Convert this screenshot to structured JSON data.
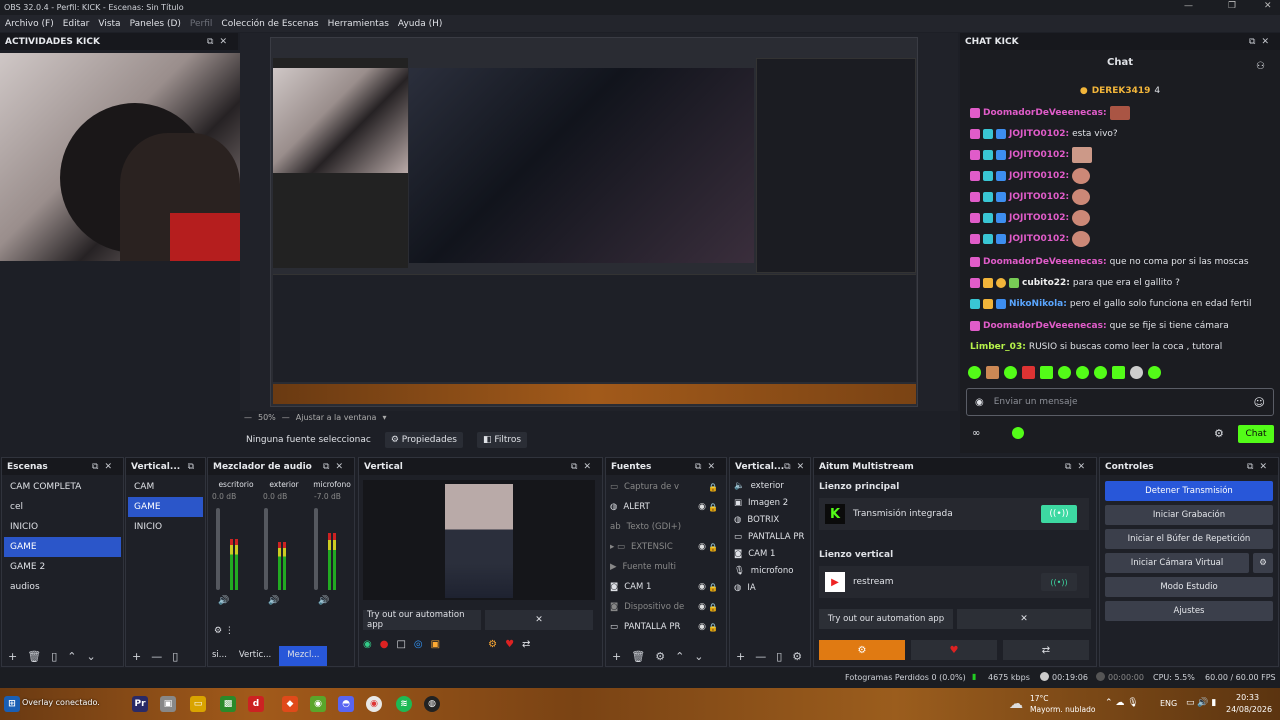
{
  "window": {
    "title": "OBS 32.0.4 - Perfil: KICK - Escenas: Sin Título"
  },
  "menu": [
    "Archivo (F)",
    "Editar",
    "Vista",
    "Paneles (D)",
    "Perfil",
    "Colección de Escenas",
    "Herramientas",
    "Ayuda (H)"
  ],
  "docks": {
    "actividades": "ACTIVIDADES KICK",
    "chat_kick": "CHAT KICK",
    "escenas": "Escenas",
    "vertical_scenes": "Vertical...",
    "mezclador": "Mezclador de audio",
    "vertical": "Vertical",
    "fuentes": "Fuentes",
    "vertical_sources": "Vertical...",
    "aitum": "Aitum Multistream",
    "controles": "Controles"
  },
  "preview": {
    "zoom": "50%",
    "fit": "Ajustar a la ventana",
    "no_source": "Ninguna fuente seleccionac",
    "props": "Propiedades",
    "filters": "Filtros"
  },
  "chat": {
    "title": "Chat",
    "pinned_user": "DEREK3419",
    "pinned_count": "4",
    "messages": [
      {
        "user": "DoomadorDeVeeenecas:",
        "text": "",
        "color": "#e05cc9"
      },
      {
        "user": "JOJITO0102:",
        "text": "esta vivo?",
        "color": "#e05cc9"
      },
      {
        "user": "JOJITO0102:",
        "text": "",
        "color": "#e05cc9"
      },
      {
        "user": "JOJITO0102:",
        "text": "",
        "color": "#e05cc9"
      },
      {
        "user": "JOJITO0102:",
        "text": "",
        "color": "#e05cc9"
      },
      {
        "user": "JOJITO0102:",
        "text": "",
        "color": "#e05cc9"
      },
      {
        "user": "JOJITO0102:",
        "text": "",
        "color": "#e05cc9"
      },
      {
        "user": "DoomadorDeVeeenecas:",
        "text": "que no coma por si las moscas",
        "color": "#e05cc9"
      },
      {
        "user": "cubito22:",
        "text": "para que era el gallito ?",
        "color": "#f0f0f0"
      },
      {
        "user": "NikoNikola:",
        "text": "pero el gallo solo funciona en edad fertil",
        "color": "#5aa6ff"
      },
      {
        "user": "DoomadorDeVeeenecas:",
        "text": "que se fije si tiene cámara",
        "color": "#e05cc9"
      },
      {
        "user": "Limber_03:",
        "text": "RUSIO si buscas como leer la coca , tutoral",
        "color": "#b7f34a"
      }
    ],
    "input_placeholder": "Enviar un mensaje",
    "send": "Chat"
  },
  "scenes": [
    "CAM COMPLETA",
    "cel",
    "INICIO",
    "GAME",
    "GAME 2",
    "audios"
  ],
  "scenes_selected": 3,
  "vertical_scenes": [
    "CAM",
    "GAME",
    "INICIO"
  ],
  "vertical_selected": 1,
  "mixer": [
    {
      "name": "escritorio",
      "db": "0.0 dB",
      "level": 0.62
    },
    {
      "name": "exterior",
      "db": "0.0 dB",
      "level": 0.58
    },
    {
      "name": "microfono",
      "db": "-7.0 dB",
      "level": 0.7
    }
  ],
  "mixer_tabs": [
    "si...",
    "Vertic...",
    "Mezcl..."
  ],
  "vertical_dock": {
    "automation": "Try out our automation app"
  },
  "sources": [
    "Captura de v",
    "ALERT",
    "Texto (GDI+)",
    "EXTENSIC",
    "Fuente multi",
    "CAM 1",
    "Dispositivo de",
    "PANTALLA PR"
  ],
  "vertical_sources": [
    "exterior",
    "Imagen 2",
    "BOTRIX",
    "PANTALLA PR",
    "CAM 1",
    "microfono",
    "IA"
  ],
  "aitum": {
    "main_canvas": "Lienzo principal",
    "integrated": "Transmisión integrada",
    "vertical_canvas": "Lienzo vertical",
    "restream": "restream",
    "automation": "Try out our automation app"
  },
  "controls": [
    "Detener Transmisión",
    "Iniciar Grabación",
    "Iniciar el Búfer de Repetición",
    "Iniciar Cámara Virtual",
    "Modo Estudio",
    "Ajustes"
  ],
  "status": {
    "frames": "Fotogramas Perdidos 0 (0.0%)",
    "kbps": "4675 kbps",
    "stream_time": "00:19:06",
    "rec_time": "00:00:00",
    "cpu": "CPU: 5.5%",
    "fps": "60.00 / 60.00 FPS"
  },
  "taskbar": {
    "overlay": "Overlay conectado.",
    "weather_temp": "17°C",
    "weather_desc": "Mayorm. nublado",
    "lang": "ENG",
    "time": "20:33",
    "date": "24/08/2026"
  },
  "colors": {
    "accent": "#2857d9",
    "kick_green": "#53fc18"
  }
}
